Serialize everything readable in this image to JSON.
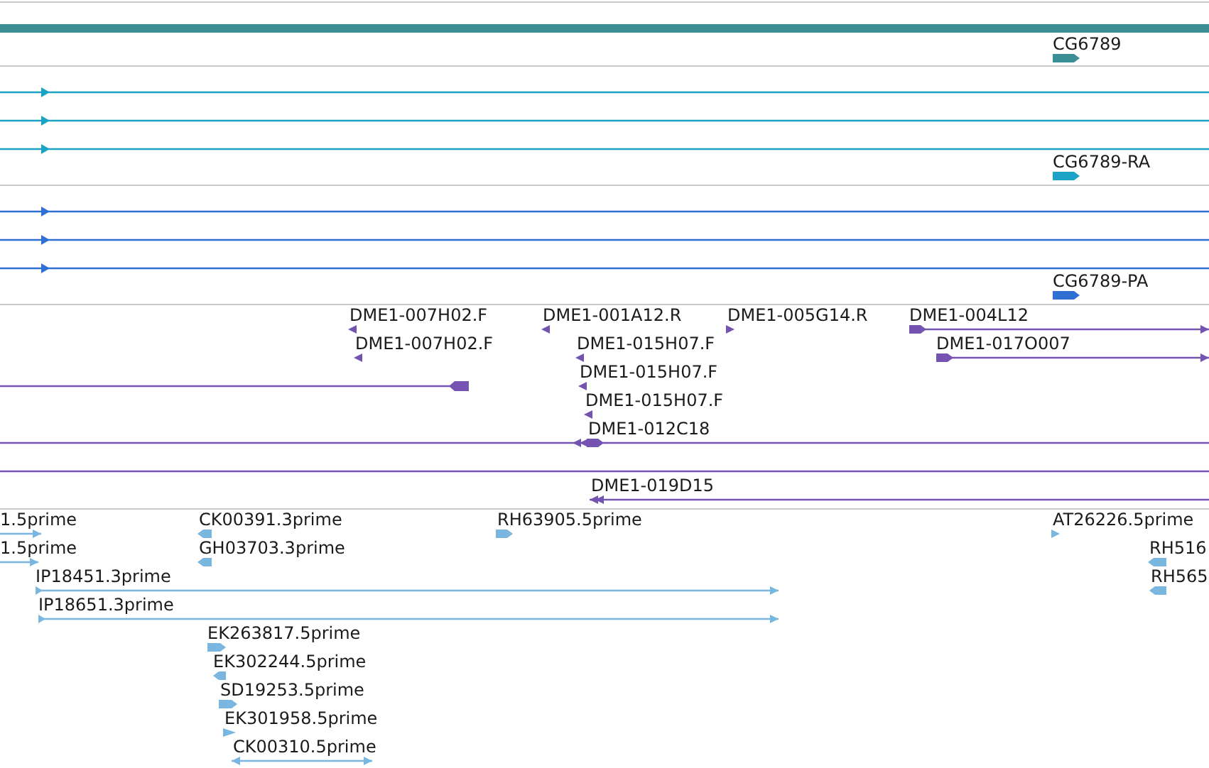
{
  "tracks": [
    {
      "color": "#3a8f94",
      "features": [
        {
          "label": "CG6789",
          "forward": true,
          "reverse": false
        }
      ]
    },
    {
      "color": "#1ba3c6",
      "features": [
        {
          "label": "CG6789-RA",
          "forward": true,
          "reverse": false
        }
      ]
    },
    {
      "color": "#2f6fd3",
      "features": [
        {
          "label": "CG6789-PA",
          "forward": true,
          "reverse": false
        }
      ]
    },
    {
      "color": "#7553b0",
      "features": [
        {
          "label": "DME1-007H02.F",
          "forward": false,
          "reverse": true
        },
        {
          "label": "DME1-001A12.R",
          "forward": false,
          "reverse": true
        },
        {
          "label": "DME1-005G14.R",
          "forward": true,
          "reverse": false
        },
        {
          "label": "DME1-004L12",
          "forward": true,
          "reverse": false
        },
        {
          "label": "DME1-007H02.F",
          "forward": false,
          "reverse": true
        },
        {
          "label": "DME1-015H07.F",
          "forward": false,
          "reverse": true
        },
        {
          "label": "DME1-017O007",
          "forward": true,
          "reverse": false
        },
        {
          "label": "DME1-015H07.F",
          "forward": false,
          "reverse": true
        },
        {
          "label": "DME1-015H07.F",
          "forward": false,
          "reverse": true
        },
        {
          "label": "DME1-012C18",
          "forward": true,
          "reverse": true
        },
        {
          "label": "DME1-019D15",
          "forward": false,
          "reverse": true
        }
      ]
    },
    {
      "color": "#7ab6e0",
      "features": [
        {
          "label": "1.5prime",
          "forward": true,
          "reverse": false
        },
        {
          "label": "CK00391.3prime",
          "forward": false,
          "reverse": true
        },
        {
          "label": "RH63905.5prime",
          "forward": true,
          "reverse": false
        },
        {
          "label": "AT26226.5prime",
          "forward": true,
          "reverse": false
        },
        {
          "label": "1.5prime",
          "forward": true,
          "reverse": false
        },
        {
          "label": "GH03703.3prime",
          "forward": false,
          "reverse": true
        },
        {
          "label": "RH516",
          "forward": false,
          "reverse": true
        },
        {
          "label": "IP18451.3prime",
          "forward": true,
          "reverse": false
        },
        {
          "label": "RH565",
          "forward": false,
          "reverse": true
        },
        {
          "label": "IP18651.3prime",
          "forward": true,
          "reverse": false
        },
        {
          "label": "EK263817.5prime",
          "forward": true,
          "reverse": false
        },
        {
          "label": "EK302244.5prime",
          "forward": false,
          "reverse": true
        },
        {
          "label": "SD19253.5prime",
          "forward": true,
          "reverse": false
        },
        {
          "label": "EK301958.5prime",
          "forward": true,
          "reverse": false
        },
        {
          "label": "CK00310.5prime",
          "forward": true,
          "reverse": true
        }
      ]
    }
  ]
}
